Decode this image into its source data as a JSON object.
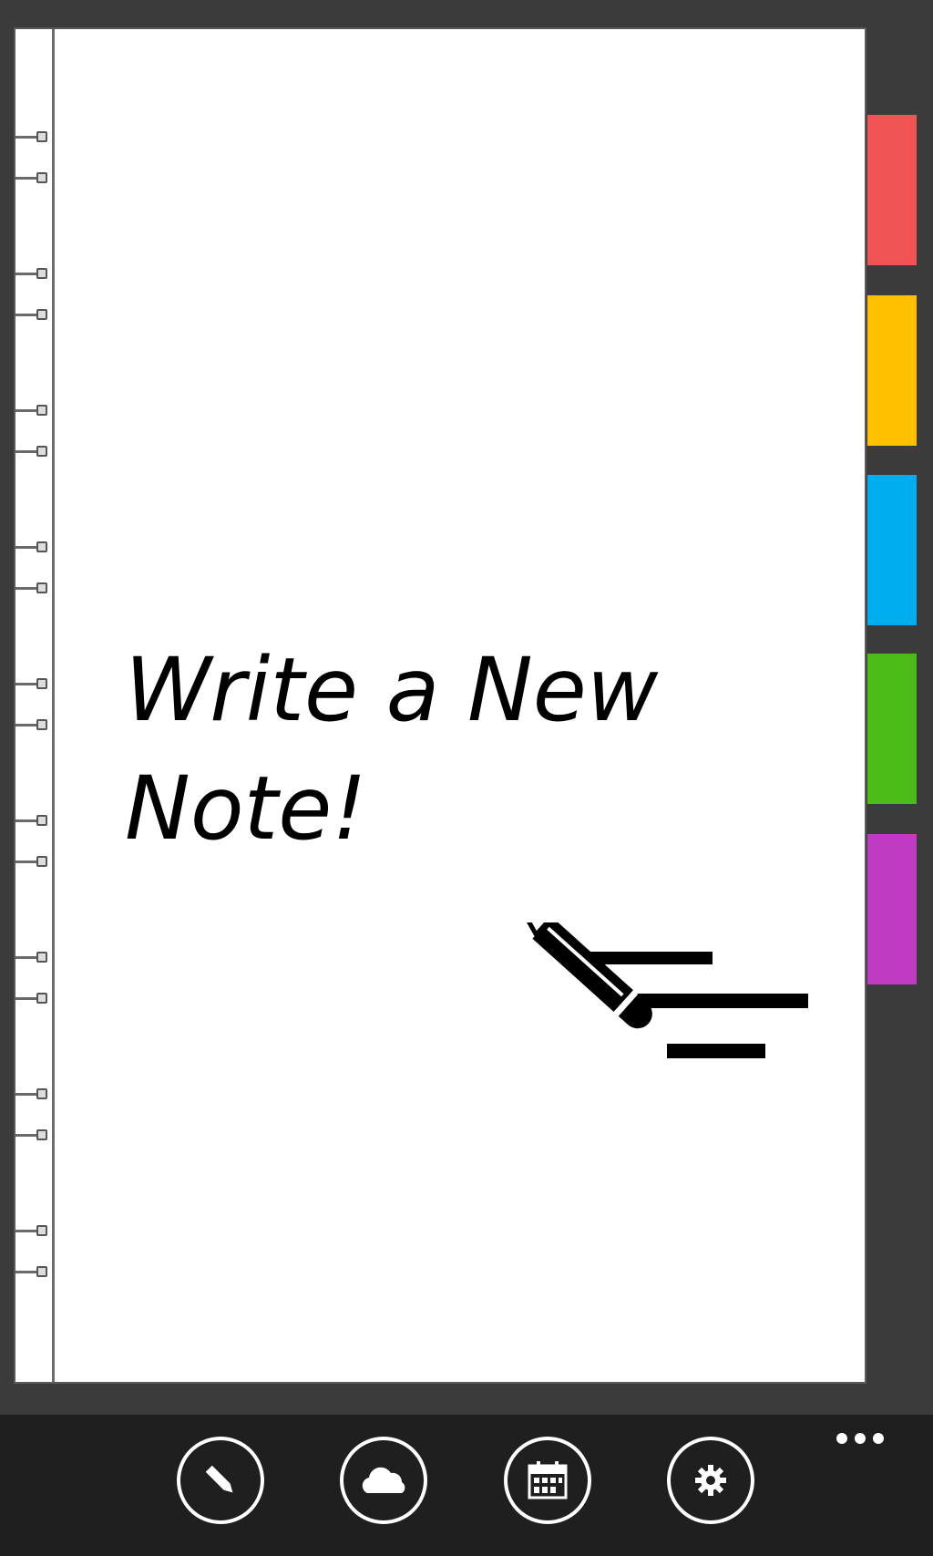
{
  "note": {
    "prompt_text": "Write a New Note!"
  },
  "tabs": [
    {
      "color": "#f25354"
    },
    {
      "color": "#ffc000"
    },
    {
      "color": "#00aeef"
    },
    {
      "color": "#4cbb17"
    },
    {
      "color": "#c03bc4"
    }
  ],
  "app_bar": {
    "buttons": [
      {
        "icon": "pencil-icon"
      },
      {
        "icon": "cloud-icon"
      },
      {
        "icon": "calendar-icon"
      },
      {
        "icon": "gear-icon"
      }
    ],
    "more_icon": "ellipsis-icon"
  }
}
